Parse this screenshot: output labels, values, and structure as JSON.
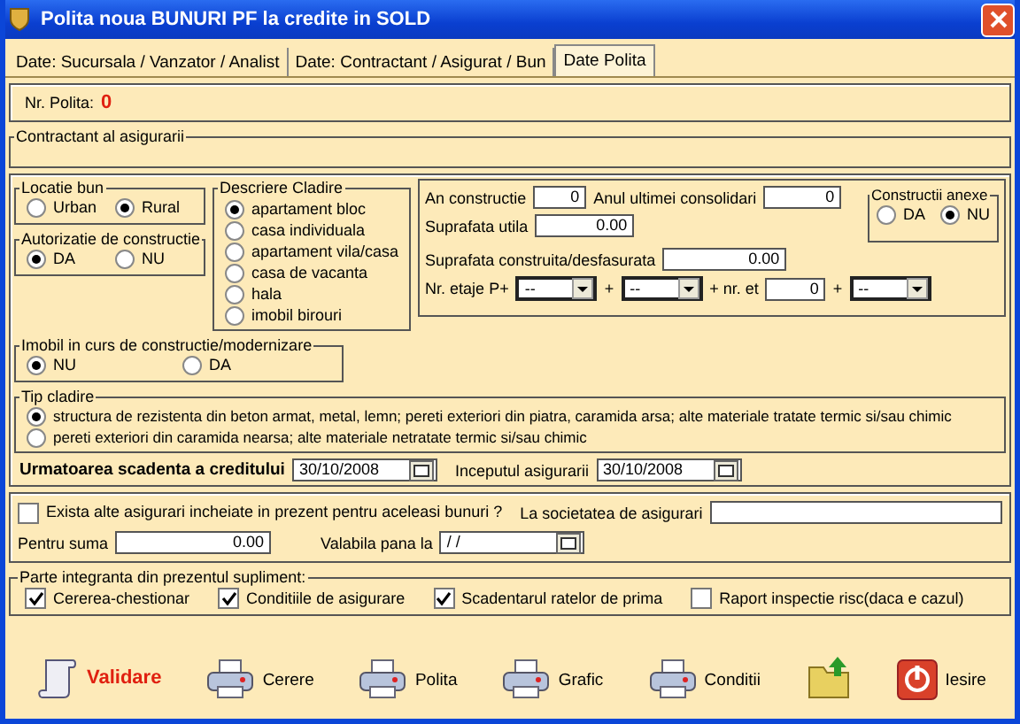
{
  "window": {
    "title": "Polita noua BUNURI PF la credite in SOLD"
  },
  "tabs": [
    {
      "label": "Date: Sucursala / Vanzator / Analist",
      "selected": false
    },
    {
      "label": "Date: Contractant / Asigurat / Bun",
      "selected": false
    },
    {
      "label": "Date Polita",
      "selected": true
    }
  ],
  "policy_number": {
    "label": "Nr. Polita:",
    "value": "0"
  },
  "contractor_group": {
    "title": "Contractant al asigurarii"
  },
  "location": {
    "title": "Locatie bun",
    "options": [
      {
        "label": "Urban",
        "selected": false
      },
      {
        "label": "Rural",
        "selected": true
      }
    ]
  },
  "authorization": {
    "title": "Autorizatie de constructie",
    "options": [
      {
        "label": "DA",
        "selected": true
      },
      {
        "label": "NU",
        "selected": false
      }
    ]
  },
  "building_description": {
    "title": "Descriere Cladire",
    "options": [
      {
        "label": "apartament bloc",
        "selected": true
      },
      {
        "label": "casa individuala",
        "selected": false
      },
      {
        "label": "apartament vila/casa",
        "selected": false
      },
      {
        "label": "casa de vacanta",
        "selected": false
      },
      {
        "label": "hala",
        "selected": false
      },
      {
        "label": "imobil birouri",
        "selected": false
      }
    ]
  },
  "construction_year": {
    "label": "An constructie",
    "value": "0"
  },
  "consolidation_year": {
    "label": "Anul ultimei consolidari",
    "value": "0"
  },
  "usable_area": {
    "label": "Suprafata utila",
    "value": "0.00"
  },
  "built_area": {
    "label": "Suprafata construita/desfasurata",
    "value": "0.00"
  },
  "floors": {
    "label": "Nr. etaje  P+",
    "parts": [
      {
        "kind": "select",
        "value": "--"
      },
      {
        "kind": "text",
        "value": "+"
      },
      {
        "kind": "select",
        "value": "--"
      },
      {
        "kind": "text",
        "value": "+ nr. et"
      },
      {
        "kind": "field",
        "value": "0"
      },
      {
        "kind": "text",
        "value": "+"
      },
      {
        "kind": "select",
        "value": "--"
      }
    ]
  },
  "annexes": {
    "title": "Constructii anexe",
    "options": [
      {
        "label": "DA",
        "selected": false
      },
      {
        "label": "NU",
        "selected": true
      }
    ]
  },
  "under_construction": {
    "title": "Imobil in curs de constructie/modernizare",
    "options": [
      {
        "label": "NU",
        "selected": true
      },
      {
        "label": "DA",
        "selected": false
      }
    ]
  },
  "building_type": {
    "title": "Tip cladire",
    "options": [
      {
        "label": "structura de rezistenta din beton armat, metal, lemn; pereti exteriori din piatra, caramida arsa; alte materiale tratate termic si/sau chimic",
        "selected": true
      },
      {
        "label": "pereti exteriori din caramida nearsa; alte materiale netratate termic si/sau chimic",
        "selected": false
      }
    ]
  },
  "next_due_date": {
    "label": "Urmatoarea scadenta a creditului",
    "value": "30/10/2008"
  },
  "insurance_start": {
    "label": "Inceputul asigurarii",
    "value": "30/10/2008"
  },
  "other_insurance": {
    "label": "Exista alte asigurari incheiate in prezent pentru aceleasi bunuri ?",
    "checked": false
  },
  "insurer": {
    "label": "La societatea de asigurari"
  },
  "amount": {
    "label": "Pentru suma",
    "value": "0.00"
  },
  "valid_until": {
    "label": "Valabila pana la",
    "value": "/ /"
  },
  "attachments": {
    "title": "Parte integranta din prezentul supliment:",
    "items": [
      {
        "label": "Cererea-chestionar",
        "checked": true
      },
      {
        "label": "Conditiile de asigurare",
        "checked": true
      },
      {
        "label": "Scadentarul ratelor de prima",
        "checked": true
      },
      {
        "label": "Raport inspectie risc(daca e cazul)",
        "checked": false
      }
    ]
  },
  "buttons": [
    {
      "kind": "validate",
      "label": "Validare"
    },
    {
      "kind": "print",
      "label": "Cerere"
    },
    {
      "kind": "print",
      "label": "Polita"
    },
    {
      "kind": "print",
      "label": "Grafic"
    },
    {
      "kind": "print",
      "label": "Conditii"
    },
    {
      "kind": "folder"
    },
    {
      "kind": "exit",
      "label": "Iesire"
    }
  ]
}
